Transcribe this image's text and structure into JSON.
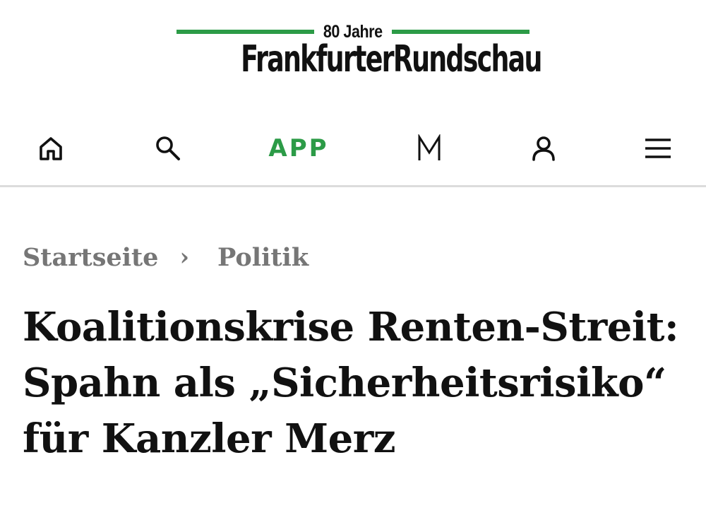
{
  "masthead": {
    "anniversary": "80 Jahre",
    "brand": "FrankfurterRundschau",
    "accent_color": "#2c9b47"
  },
  "nav": {
    "home_icon": "home-icon",
    "search_icon": "search-icon",
    "app_label": "APP",
    "m_icon": "m-logo-icon",
    "user_icon": "user-icon",
    "menu_icon": "menu-icon"
  },
  "breadcrumb": {
    "items": [
      "Startseite",
      "Politik"
    ],
    "separator": "›"
  },
  "article": {
    "headline": "Koalitionskrise Renten-Streit: Spahn als „Sicherheitsrisiko“ für Kanzler Merz"
  }
}
